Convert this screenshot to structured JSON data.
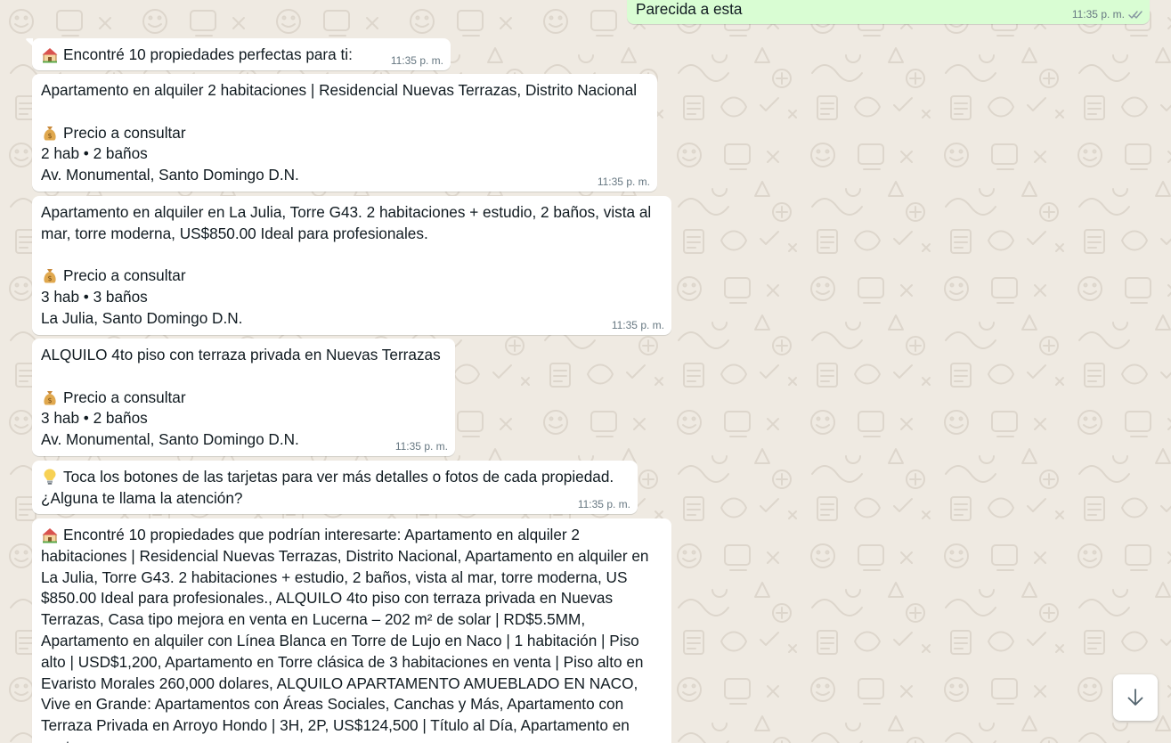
{
  "conversation": {
    "outgoing_text": "Parecida a esta",
    "outgoing_time": "11:35 p. m.",
    "outgoing_status_icon": "double-check-icon",
    "messages": [
      {
        "icon": "house-with-garden-emoji",
        "text": "Encontré 10 propiedades perfectas para ti:",
        "time": "11:35 p. m."
      },
      {
        "text": "Apartamento en alquiler 2 habitaciones | Residencial Nuevas Terrazas, Distrito Nacional\n\n",
        "icon": "money-bag-emoji",
        "after": "Precio a consultar\n2 hab • 2 baños\nAv. Monumental, Santo Domingo D.N.",
        "time": "11:35 p. m."
      },
      {
        "text": "Apartamento en alquiler en La Julia, Torre G43. 2 habitaciones + estudio, 2 baños, vista al mar, torre moderna, US$850.00 Ideal para profesionales.\n\n",
        "icon": "money-bag-emoji",
        "after": "Precio a consultar\n3 hab • 3 baños\nLa Julia, Santo Domingo D.N.",
        "time": "11:35 p. m."
      },
      {
        "text": "ALQUILO 4to piso con terraza privada en Nuevas Terrazas\n\n",
        "icon": "money-bag-emoji",
        "after": "Precio a consultar\n3 hab • 2 baños\nAv. Monumental, Santo Domingo D.N.",
        "time": "11:35 p. m."
      },
      {
        "icon": "light-bulb-emoji",
        "text": "Toca los botones de las tarjetas para ver más detalles o fotos de cada propiedad.\n¿Alguna te llama la atención?",
        "time": "11:35 p. m."
      },
      {
        "icon": "house-with-garden-emoji",
        "text": "Encontré 10 propiedades que podrían interesarte: Apartamento en alquiler 2 habitaciones | Residencial Nuevas Terrazas, Distrito Nacional, Apartamento en alquiler en La Julia, Torre G43. 2 habitaciones + estudio, 2 baños, vista al mar, torre moderna, US $850.00 Ideal para profesionales., ALQUILO 4to piso con terraza privada en Nuevas Terrazas, Casa tipo mejora en venta en Lucerna – 202 m² de solar | RD$5.5MM, Apartamento en alquiler con Línea Blanca en Torre de Lujo en Naco | 1 habitación | Piso alto | USD$1,200, Apartamento en Torre clásica de 3 habitaciones en venta | Piso alto en Evaristo Morales 260,000 dolares, ALQUILO APARTAMENTO AMUEBLADO EN NACO, Vive en Grande: Apartamentos con Áreas Sociales, Canchas y Más, Apartamento con Terraza Privada en Arroyo Hondo | 3H, 2P, US$124,500 | Título al Día, Apartamento en venta en"
      }
    ]
  },
  "scroll_down_icon": "arrow-down-icon",
  "colors": {
    "chat_background": "#efeae2",
    "incoming_bubble": "#ffffff",
    "outgoing_bubble": "#d9fdd3",
    "timestamp": "#667781",
    "read_tick": "#8696a0"
  }
}
